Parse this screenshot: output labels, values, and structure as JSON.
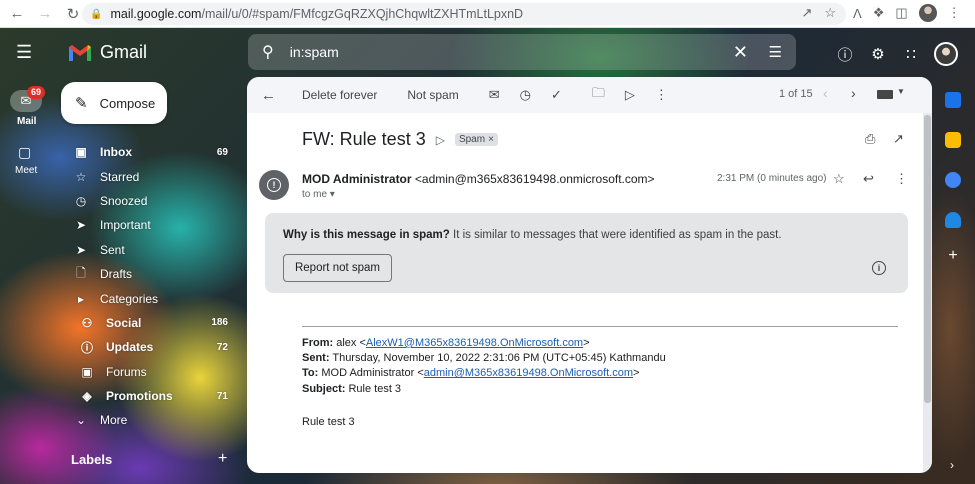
{
  "browser": {
    "url_host": "mail.google.com",
    "url_path": "/mail/u/0/#spam/FMfcgzGqRZXQjhChqwltZXHTmLtLpxnD"
  },
  "app": {
    "name": "Gmail",
    "search_value": "in:spam"
  },
  "rail": {
    "mail_label": "Mail",
    "mail_badge": "69",
    "meet_label": "Meet"
  },
  "compose_label": "Compose",
  "nav": [
    {
      "label": "Inbox",
      "count": "69"
    },
    {
      "label": "Starred",
      "count": ""
    },
    {
      "label": "Snoozed",
      "count": ""
    },
    {
      "label": "Important",
      "count": ""
    },
    {
      "label": "Sent",
      "count": ""
    },
    {
      "label": "Drafts",
      "count": ""
    },
    {
      "label": "Categories",
      "count": ""
    },
    {
      "label": "Social",
      "count": "186"
    },
    {
      "label": "Updates",
      "count": "72"
    },
    {
      "label": "Forums",
      "count": ""
    },
    {
      "label": "Promotions",
      "count": "71"
    },
    {
      "label": "More",
      "count": ""
    }
  ],
  "labels_title": "Labels",
  "toolbar": {
    "delete_forever": "Delete forever",
    "not_spam": "Not spam",
    "pager": "1 of 15"
  },
  "message": {
    "subject": "FW: Rule test 3",
    "chip": "Spam",
    "sender_name": "MOD Administrator",
    "sender_email": "<admin@m365x83619498.onmicrosoft.com>",
    "to_me": "to me",
    "time": "2:31 PM (0 minutes ago)",
    "spam_question": "Why is this message in spam?",
    "spam_reason": " It is similar to messages that were identified as spam in the past.",
    "report_button": "Report not spam",
    "from_label": "From:",
    "from_name": " alex <",
    "from_email": "AlexW1@M365x83619498.OnMicrosoft.com",
    "from_close": ">",
    "sent_label": "Sent:",
    "sent_value": " Thursday, November 10, 2022 2:31:06 PM (UTC+05:45) Kathmandu",
    "to_label": "To:",
    "to_name": " MOD Administrator <",
    "to_email": "admin@M365x83619498.OnMicrosoft.com",
    "to_close": ">",
    "subject_label": "Subject:",
    "subject_value": " Rule test 3",
    "body": "Rule test 3"
  },
  "colors": {
    "badge": "#d93025",
    "link": "#1a5fb4",
    "panel": "#ffffff",
    "spam_box": "#e4e5e6"
  }
}
